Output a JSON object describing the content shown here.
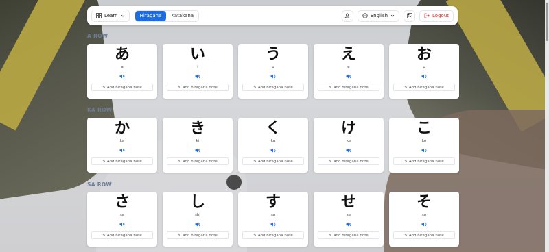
{
  "header": {
    "learn_label": "Learn",
    "tabs": [
      {
        "label": "Hiragana",
        "active": true
      },
      {
        "label": "Katakana",
        "active": false
      }
    ],
    "language_label": "English",
    "logout_label": "Logout"
  },
  "colors": {
    "accent": "#1d6ce0",
    "logout": "#d93025",
    "row_title": "#6a7d9a"
  },
  "rows": [
    {
      "title": "A ROW",
      "cards": [
        {
          "kana": "あ",
          "romaji": "a",
          "note": "Add hiragana note"
        },
        {
          "kana": "い",
          "romaji": "i",
          "note": "Add hiragana note"
        },
        {
          "kana": "う",
          "romaji": "u",
          "note": "Add hiragana note"
        },
        {
          "kana": "え",
          "romaji": "e",
          "note": "Add hiragana note"
        },
        {
          "kana": "お",
          "romaji": "o",
          "note": "Add hiragana note"
        }
      ]
    },
    {
      "title": "KA ROW",
      "cards": [
        {
          "kana": "か",
          "romaji": "ka",
          "note": "Add hiragana note"
        },
        {
          "kana": "き",
          "romaji": "ki",
          "note": "Add hiragana note"
        },
        {
          "kana": "く",
          "romaji": "ku",
          "note": "Add hiragana note"
        },
        {
          "kana": "け",
          "romaji": "ke",
          "note": "Add hiragana note"
        },
        {
          "kana": "こ",
          "romaji": "ko",
          "note": "Add hiragana note"
        }
      ]
    },
    {
      "title": "SA ROW",
      "cards": [
        {
          "kana": "さ",
          "romaji": "sa",
          "note": "Add hiragana note"
        },
        {
          "kana": "し",
          "romaji": "shi",
          "note": "Add hiragana note"
        },
        {
          "kana": "す",
          "romaji": "su",
          "note": "Add hiragana note"
        },
        {
          "kana": "せ",
          "romaji": "se",
          "note": "Add hiragana note"
        },
        {
          "kana": "そ",
          "romaji": "so",
          "note": "Add hiragana note"
        }
      ]
    }
  ]
}
